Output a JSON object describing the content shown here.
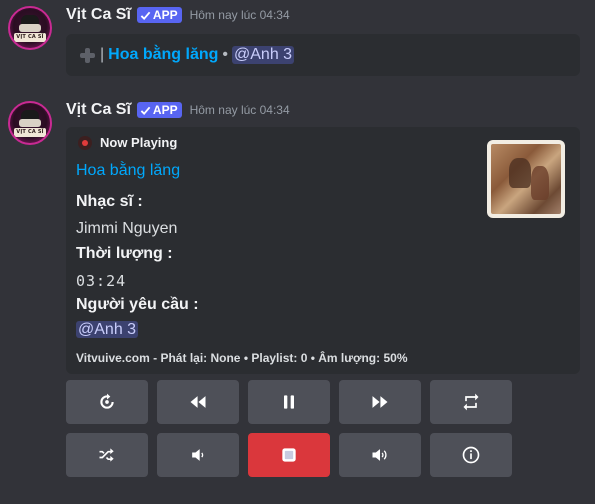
{
  "message1": {
    "author": "Vịt Ca Sĩ",
    "badge": "APP",
    "timestamp": "Hôm nay lúc 04:34",
    "avatar_text": "VỊT CA SĨ",
    "separator": "|",
    "song": "Hoa bằng lăng",
    "dot": "•",
    "mention": "@Anh 3",
    "icon": "plus-icon"
  },
  "message2": {
    "author": "Vịt Ca Sĩ",
    "badge": "APP",
    "timestamp": "Hôm nay lúc 04:34",
    "avatar_text": "VỊT CA SĨ",
    "embed": {
      "author": "Now Playing",
      "title": "Hoa bằng lăng",
      "fields": [
        {
          "name": "Nhạc sĩ :",
          "value": "Jimmi Nguyen"
        },
        {
          "name": "Thời lượng :",
          "value": "03:24"
        },
        {
          "name": "Người yêu cầu :",
          "value": "@Anh 3"
        }
      ],
      "footer": "Vitvuive.com - Phát lại: None • Playlist: 0 • Âm lượng: 50%"
    }
  },
  "controls": {
    "row1": [
      "replay-icon",
      "rewind-icon",
      "pause-icon",
      "fast-forward-icon",
      "repeat-icon"
    ],
    "row2": [
      "shuffle-icon",
      "volume-down-icon",
      "stop-icon",
      "volume-up-icon",
      "info-icon"
    ],
    "stop_color": "#da373c",
    "button_color": "#4e5058"
  },
  "colors": {
    "background": "#323339",
    "embed": "#2b2d31",
    "link": "#00a8fc",
    "badge": "#5865f2",
    "mention_bg": "#3c4270"
  }
}
